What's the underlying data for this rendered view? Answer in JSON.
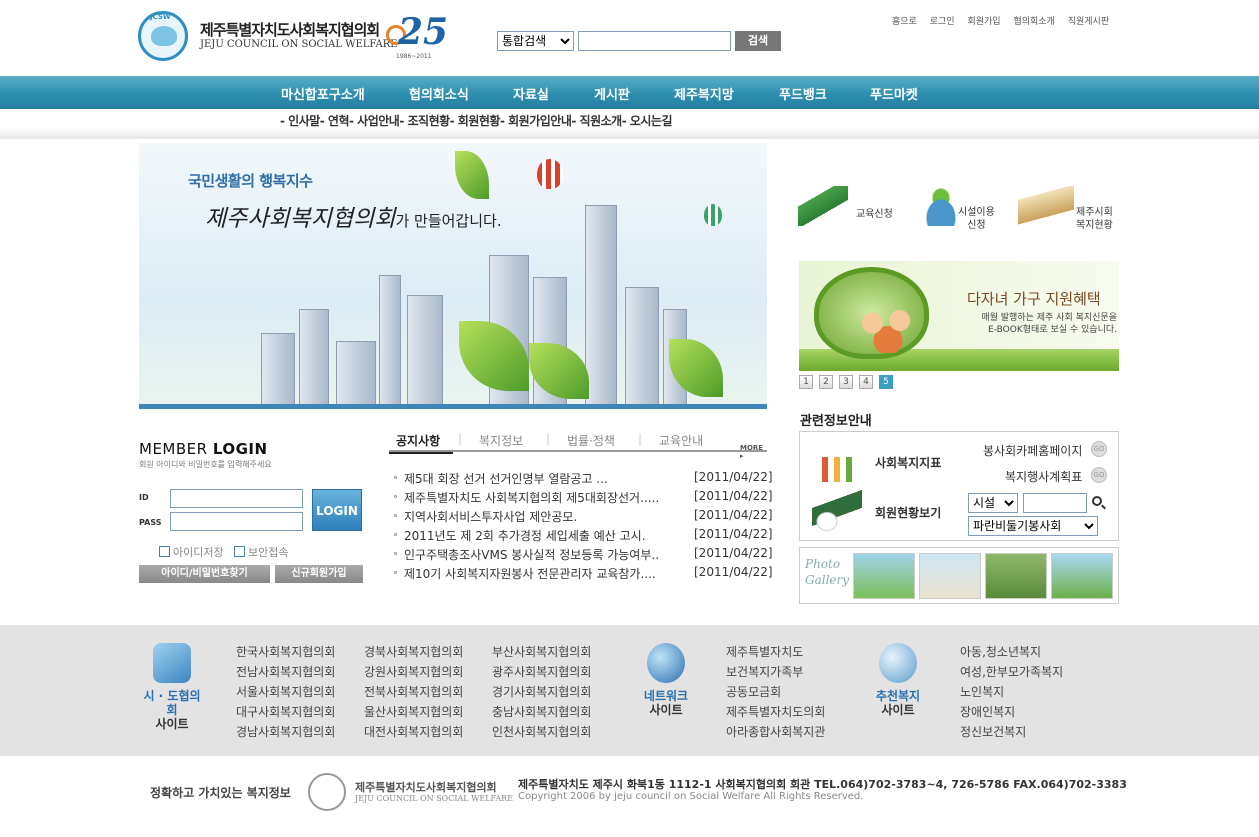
{
  "header": {
    "logo_korean": "제주특별자치도사회복지협의회",
    "logo_english": "JEJU COUNCIL ON SOCIAL WELFARE",
    "logo_mark": "JCSW",
    "anniversary": "25",
    "anniversary_years": "1986~2011",
    "search_select": "통합검색",
    "search_button": "검색",
    "top_links": [
      "홈으로",
      "로그인",
      "회원가입",
      "협의회소개",
      "직원게시판"
    ]
  },
  "nav": {
    "items": [
      "마신합포구소개",
      "협의회소식",
      "자료실",
      "게시판",
      "제주복지망",
      "푸드뱅크",
      "푸드마켓"
    ],
    "subnav": "- 인사말- 연혁- 사업안내- 조직현황- 회원현황- 회원가입안내- 직원소개- 오시는길"
  },
  "banner": {
    "subtitle": "국민생활의 행복지수",
    "title": "제주사회복지협의회",
    "title_suffix": "가 만들어갑니다."
  },
  "quick_links": [
    {
      "label": "교육신청",
      "icon": "book-icon"
    },
    {
      "label": "시설이용\n신청",
      "icon": "sprout-icon"
    },
    {
      "label": "제주시회\n복지현황",
      "icon": "open-book-icon"
    }
  ],
  "side_banner": {
    "title": "다자녀 가구 지원혜택",
    "desc_line1": "매월 발행하는 제주 사회 복지신문을",
    "desc_line2": "E-BOOK형태로 보실 수 있습니다.",
    "pages": [
      "1",
      "2",
      "3",
      "4",
      "5"
    ],
    "active_page": "5"
  },
  "related": {
    "title": "관련정보안내",
    "item1": "사회복지지표",
    "item2": "회원현황보기",
    "link1": "봉사회카페홈페이지",
    "link2": "복지행사계획표",
    "select1": "시설",
    "select2": "파란비둘기봉사회",
    "go_label": "GO"
  },
  "gallery": {
    "label_line1": "Photo",
    "label_line2": "Gallery"
  },
  "login": {
    "title_a": "MEMBER",
    "title_b": "LOGIN",
    "hint": "회원 아이디와 비밀번호를 입력해주세요",
    "id_label": "ID",
    "pass_label": "PASS",
    "button": "LOGIN",
    "save_id": "아이디저장",
    "secure": "보안접속",
    "find_button": "아이디/비밀번호찾기",
    "join_button": "신규회원가입"
  },
  "notice": {
    "tabs": [
      "공지사항",
      "복지정보",
      "법률·정책",
      "교육안내"
    ],
    "more": "MORE ▸",
    "items": [
      {
        "title": "제5대 회장 선거 선거인명부 열람공고 ...",
        "date": "[2011/04/22]"
      },
      {
        "title": "제주특별자치도 사회복지협의회 제5대회장선거.....",
        "date": "[2011/04/22]"
      },
      {
        "title": "지역사회서비스투자사업 제안공모.",
        "date": "[2011/04/22]"
      },
      {
        "title": "2011년도 제 2회 추가경정 세입세출 예산 고시.",
        "date": "[2011/04/22]"
      },
      {
        "title": "인구주택총조사VMS 봉사실적 정보등록 가능여부..",
        "date": "[2011/04/22]"
      },
      {
        "title": "제10기 사회복지자원봉사 전문관리자 교육참가....",
        "date": "[2011/04/22]"
      }
    ]
  },
  "footer": {
    "group1_a": "시 · 도협의회",
    "group1_b": "사이트",
    "group2_a": "네트워크",
    "group2_b": "사이트",
    "group3_a": "추천복지",
    "group3_b": "사이트",
    "col1": [
      "한국사회복지협의회",
      "전남사회복지협의회",
      "서울사회복지협의회",
      "대구사회복지협의회",
      "경남사회복지협의회"
    ],
    "col2": [
      "경북사회복지협의회",
      "강원사회복지협의회",
      "전북사회복지협의회",
      "울산사회복지협의회",
      "대전사회복지협의회"
    ],
    "col3": [
      "부산사회복지협의회",
      "광주사회복지협의회",
      "경기사회복지협의회",
      "충남사회복지협의회",
      "인천사회복지협의회"
    ],
    "col4": [
      "제주특별자치도",
      "보건복지가족부",
      "공동모금회",
      "제주특별자치도의회",
      "아라종합사회복지관"
    ],
    "col5": [
      "아동,청소년복지",
      "여성,한부모가족복지",
      "노인복지",
      "장애인복지",
      "정신보건복지"
    ],
    "slogan": "정확하고 가치있는 복지정보",
    "logo_korean": "제주특별자치도사회복지협의회",
    "logo_english": "JEJU COUNCIL ON SOCIAL WELFARE",
    "address": "제주특별자치도 제주시 화북1동 1112-1 사회복지협의회 회관   TEL.064)702-3783~4, 726-5786  FAX.064)702-3383",
    "copyright": "Copyright 2006 by jeju council on Social Welfare All Rights Reserved."
  }
}
